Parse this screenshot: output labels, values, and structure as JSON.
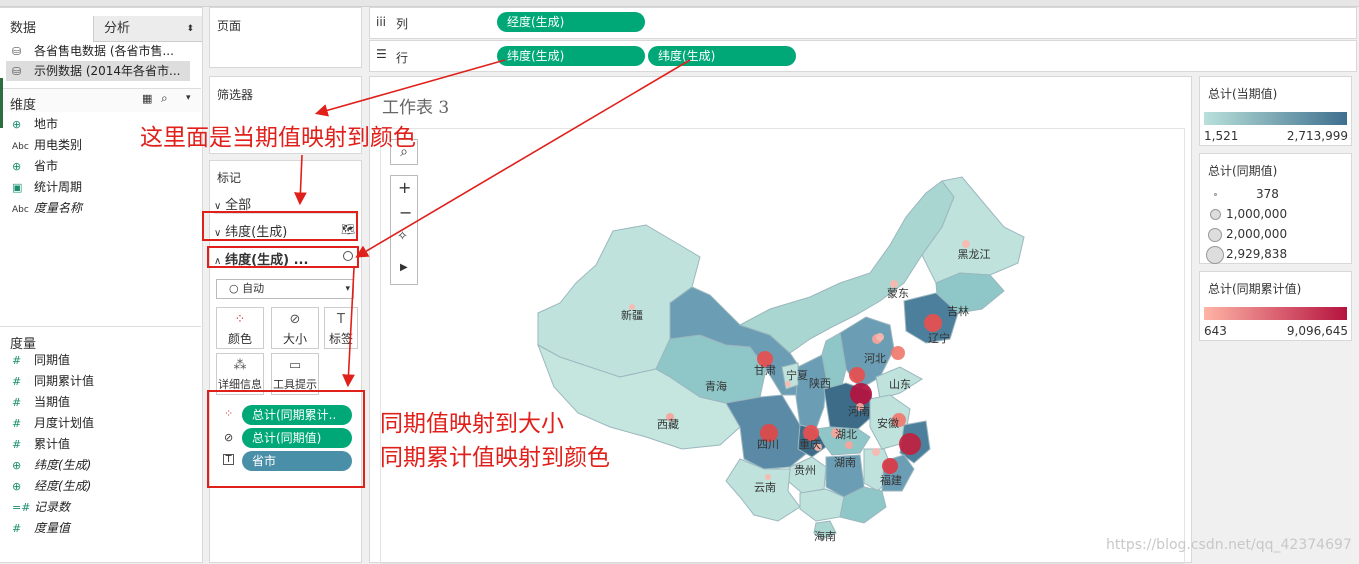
{
  "left_panel": {
    "tabs": [
      "数据",
      "分析"
    ],
    "datasources": [
      "各省售电数据 (各省市售...",
      "示例数据 (2014年各省市..."
    ],
    "dimensions_label": "维度",
    "dimensions": [
      {
        "icon": "globe",
        "label": "地市"
      },
      {
        "icon": "Abc",
        "label": "用电类别"
      },
      {
        "icon": "globe",
        "label": "省市"
      },
      {
        "icon": "calendar",
        "label": "统计周期"
      },
      {
        "icon": "Abc",
        "label": "度量名称"
      }
    ],
    "measures_label": "度量",
    "measures": [
      {
        "icon": "#",
        "label": "同期值"
      },
      {
        "icon": "#",
        "label": "同期累计值"
      },
      {
        "icon": "#",
        "label": "当期值"
      },
      {
        "icon": "#",
        "label": "月度计划值"
      },
      {
        "icon": "#",
        "label": "累计值"
      },
      {
        "icon": "globe",
        "label": "纬度(生成)"
      },
      {
        "icon": "globe",
        "label": "经度(生成)"
      },
      {
        "icon": "=#",
        "label": "记录数"
      },
      {
        "icon": "#",
        "label": "度量值"
      }
    ]
  },
  "shelves": {
    "pages_label": "页面",
    "filters_label": "筛选器",
    "columns_label": "列",
    "rows_label": "行",
    "columns_pill": "经度(生成)",
    "rows_pills": [
      "纬度(生成)",
      "纬度(生成)"
    ]
  },
  "marks": {
    "title": "标记",
    "all_label": "全部",
    "layer1": "纬度(生成)",
    "layer2": "纬度(生成) ...",
    "mark_type": "自动",
    "cards": [
      "颜色",
      "大小",
      "标签",
      "详细信息",
      "工具提示"
    ],
    "encodings": [
      "总计(同期累计..",
      "总计(同期值)",
      "省市"
    ]
  },
  "worksheet": {
    "title": "工作表 3",
    "provinces": [
      "黑龙江",
      "吉林",
      "辽宁",
      "蒙东",
      "新疆",
      "甘肃",
      "宁夏",
      "陕西",
      "河北",
      "山东",
      "青海",
      "西藏",
      "河南",
      "安徽",
      "湖北",
      "四川",
      "重庆",
      "贵州",
      "湖南",
      "福建",
      "云南",
      "海南"
    ]
  },
  "legends": {
    "color1": {
      "title": "总计(当期值)",
      "min": "1,521",
      "max": "2,713,999",
      "from": "#b9e0da",
      "to": "#3e6f8e"
    },
    "size": {
      "title": "总计(同期值)",
      "items": [
        "378",
        "1,000,000",
        "2,000,000",
        "2,929,838"
      ]
    },
    "color2": {
      "title": "总计(同期累计值)",
      "min": "643",
      "max": "9,096,645",
      "from": "#ffb4a6",
      "to": "#b5123e"
    }
  },
  "annotations": {
    "top": "这里面是当期值映射到颜色",
    "bottom_1": "同期值映射到大小",
    "bottom_2": "同期累计值映射到颜色"
  },
  "watermark": "https://blog.csdn.net/qq_42374697"
}
